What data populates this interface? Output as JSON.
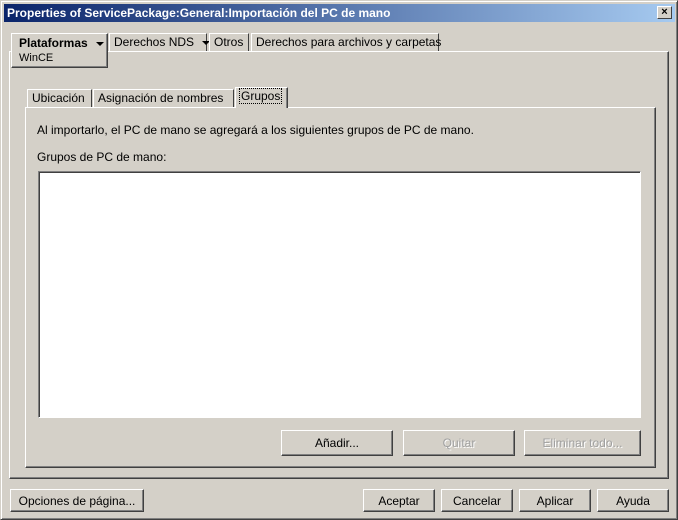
{
  "window": {
    "title": "Properties of ServicePackage:General:Importación del PC de mano",
    "close_label": "×"
  },
  "main_tabs": [
    {
      "label": "Plataformas",
      "sub": "WinCE"
    },
    {
      "label": "Derechos NDS"
    },
    {
      "label": "Otros"
    },
    {
      "label": "Derechos para archivos y carpetas"
    }
  ],
  "sub_tabs": [
    "Ubicación",
    "Asignación de nombres",
    "Grupos"
  ],
  "content": {
    "description": "Al importarlo, el PC de mano se agregará a los siguientes grupos de PC de mano.",
    "list_label": "Grupos de PC de mano:",
    "list_items": []
  },
  "list_buttons": {
    "add": "Añadir...",
    "remove": "Quitar",
    "remove_all": "Eliminar todo..."
  },
  "footer": {
    "page_options": "Opciones de página...",
    "ok": "Aceptar",
    "cancel": "Cancelar",
    "apply": "Aplicar",
    "help": "Ayuda"
  }
}
